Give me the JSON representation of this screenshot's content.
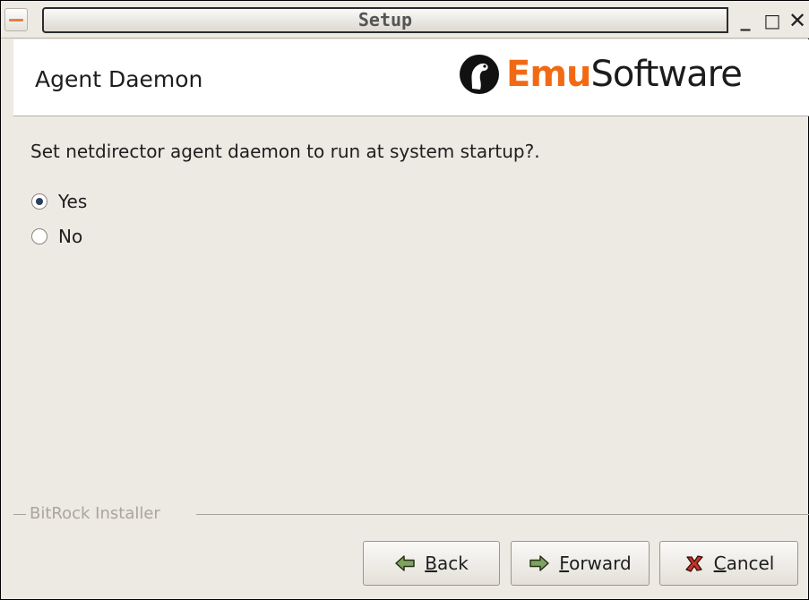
{
  "window": {
    "title": "Setup",
    "minimize_glyph": "_",
    "maximize_glyph": "□",
    "close_glyph": "✕"
  },
  "header": {
    "title": "Agent Daemon",
    "logo_part1": "Emu",
    "logo_part2": "Software",
    "logo_accent_color": "#f16a13"
  },
  "content": {
    "question": "Set netdirector agent daemon to run at system startup?.",
    "options": [
      {
        "label": "Yes",
        "checked": true
      },
      {
        "label": "No",
        "checked": false
      }
    ]
  },
  "footer": {
    "frame_label": "BitRock Installer"
  },
  "buttons": {
    "back": {
      "mnemonic": "B",
      "rest": "ack",
      "icon": "arrow-left-icon"
    },
    "forward": {
      "mnemonic": "F",
      "rest": "orward",
      "icon": "arrow-right-icon"
    },
    "cancel": {
      "mnemonic": "C",
      "rest": "ancel",
      "icon": "cancel-x-icon"
    }
  }
}
